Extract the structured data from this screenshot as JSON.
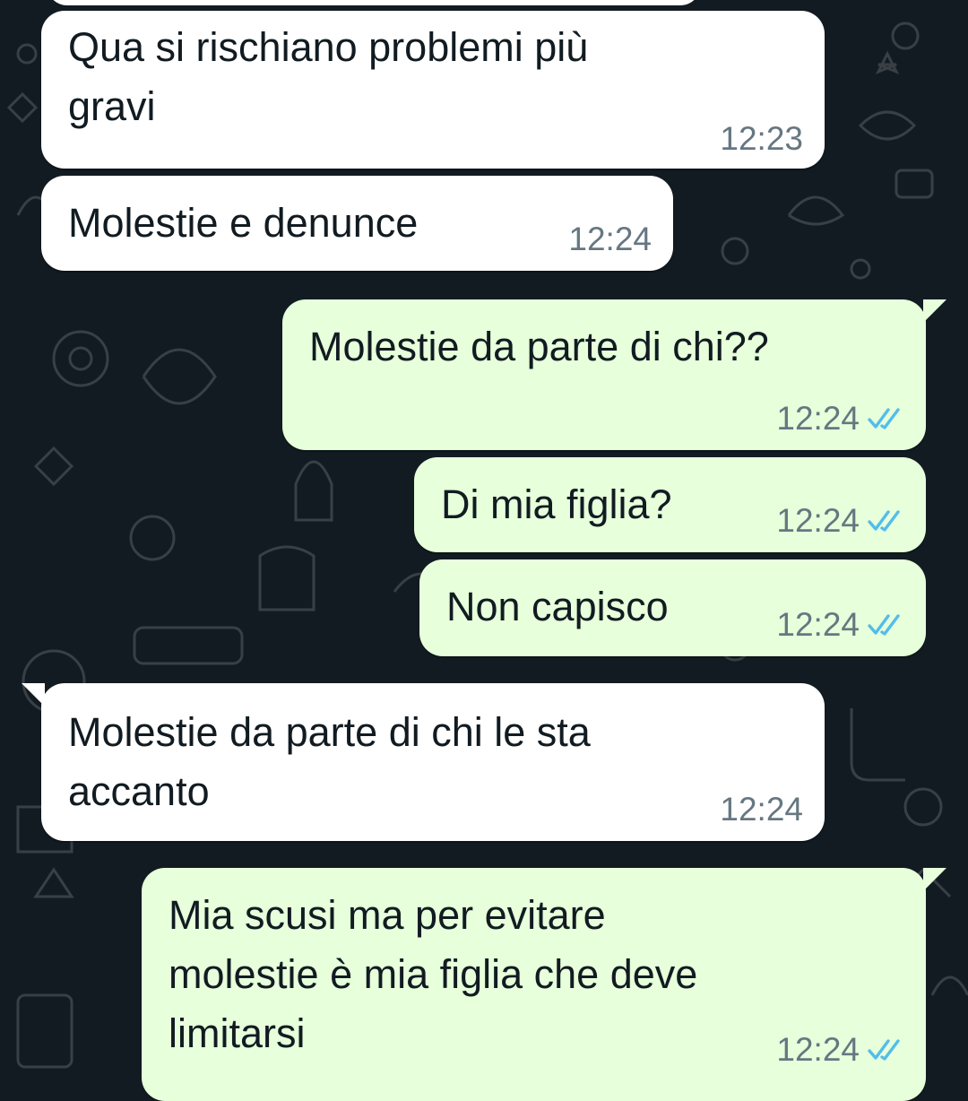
{
  "colors": {
    "background": "#121b22",
    "incoming_bubble": "#ffffff",
    "outgoing_bubble": "#e7ffdb",
    "text": "#111b21",
    "time": "#667781",
    "read_ticks": "#53bdeb"
  },
  "messages": [
    {
      "direction": "incoming",
      "text": "Qua si rischiano problemi più\ngravi",
      "time": "12:23"
    },
    {
      "direction": "incoming",
      "text": "Molestie e denunce",
      "time": "12:24"
    },
    {
      "direction": "outgoing",
      "text": "Molestie da parte di chi??",
      "time": "12:24",
      "status_icon": "double-check-read-icon"
    },
    {
      "direction": "outgoing",
      "text": "Di mia figlia?",
      "time": "12:24",
      "status_icon": "double-check-read-icon"
    },
    {
      "direction": "outgoing",
      "text": "Non capisco",
      "time": "12:24",
      "status_icon": "double-check-read-icon"
    },
    {
      "direction": "incoming",
      "text": "Molestie da parte di chi le sta\naccanto",
      "time": "12:24"
    },
    {
      "direction": "outgoing",
      "text": "Mia scusi ma per evitare\nmolestie è mia figlia che deve\nlimitarsi",
      "time": "12:24",
      "status_icon": "double-check-read-icon"
    }
  ]
}
